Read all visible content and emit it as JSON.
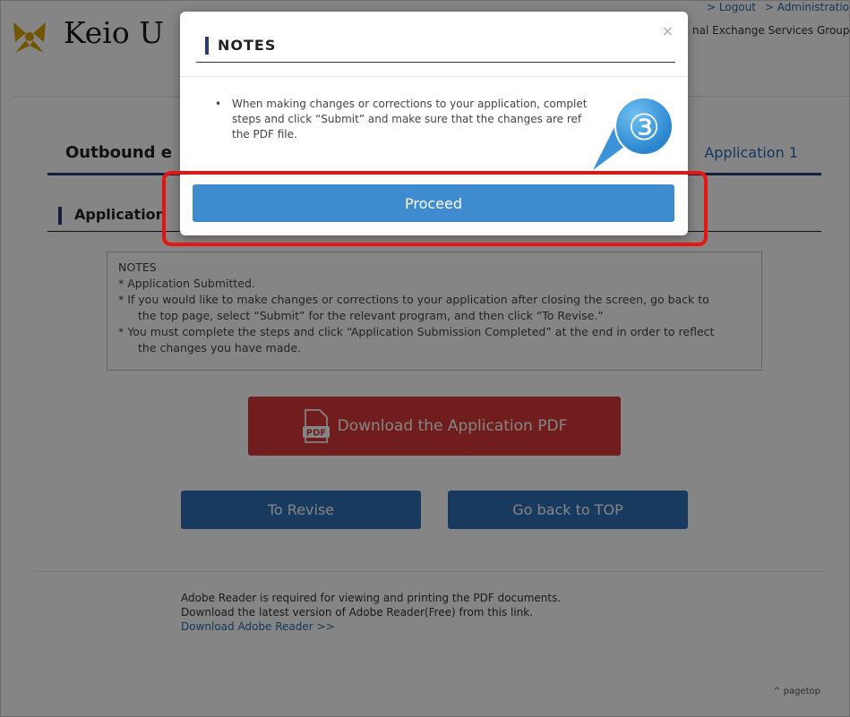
{
  "header": {
    "logo_text": "Keio U",
    "links": [
      "Logout",
      "Administratio"
    ],
    "group": "nal Exchange Services Group"
  },
  "title_bar": {
    "title": "Outbound e",
    "application_tab": "Application 1"
  },
  "section": {
    "title": "Application"
  },
  "notes": {
    "heading": "NOTES",
    "lines": [
      "* Application Submitted.",
      "* If you would like to make changes or corrections to your application after closing the screen, go back to",
      "the top page, select “Submit” for the relevant program, and then click “To Revise.”",
      "* You must complete the steps and click “Application Submission Completed” at the end in order to reflect",
      "the changes you have made."
    ]
  },
  "buttons": {
    "download_pdf": "Download the Application PDF",
    "pdf_icon_label": "PDF",
    "to_revise": "To Revise",
    "go_back_top": "Go back to TOP"
  },
  "footer": {
    "line1": "Adobe Reader is required for viewing and printing the PDF documents.",
    "line2": "Download the latest version of Adobe Reader(Free) from this link.",
    "link": "Download Adobe Reader >>",
    "pagetop": "pagetop"
  },
  "modal": {
    "title": "NOTES",
    "close": "×",
    "bullet": "•",
    "body_lines": [
      "When making changes or corrections to your application, complet",
      "steps and click “Submit” and make sure that the changes are ref",
      "the PDF file."
    ],
    "proceed": "Proceed"
  },
  "annotation": {
    "step": "③"
  },
  "colors": {
    "accent_navy": "#2b3a7a",
    "link_blue": "#2a6ab0",
    "button_blue": "#2f6fb4",
    "proceed_blue": "#3f8bd0",
    "pdf_red": "#d93838",
    "highlight_red": "#e8140f",
    "logo_gold": "#d9a400"
  },
  "icons": [
    "keio-logo-icon",
    "pdf-file-icon",
    "close-icon",
    "chevron-up-icon"
  ]
}
